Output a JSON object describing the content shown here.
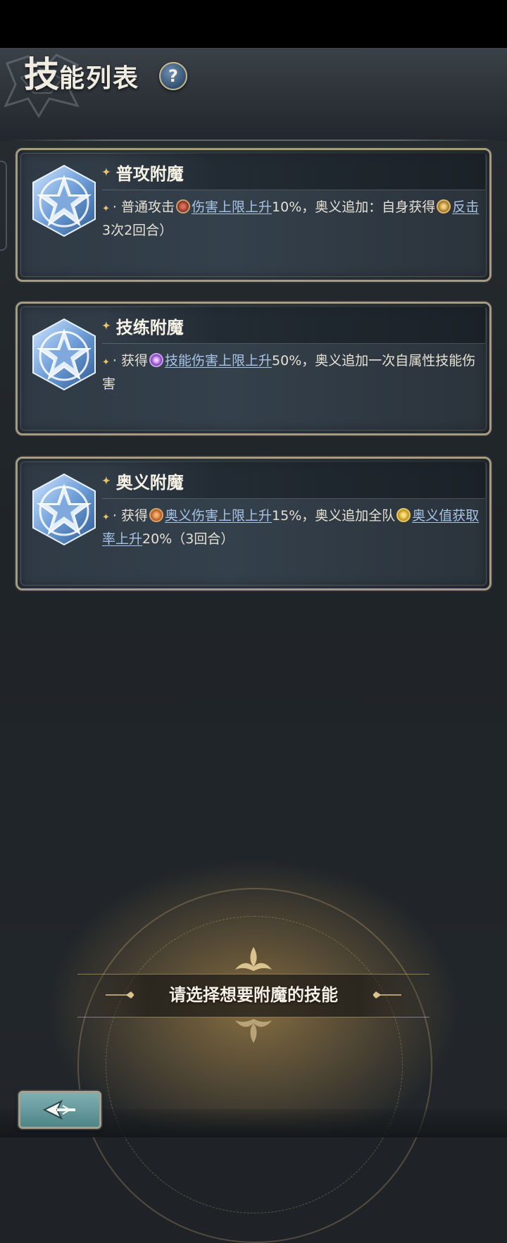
{
  "header": {
    "title_first": "技",
    "title_rest": "能列表",
    "help_label": "?"
  },
  "skills": [
    {
      "name": "普攻附魔",
      "desc": {
        "t1": "· 普通攻击",
        "k1": "伤害上限上升",
        "t2": "10%，奥义追加：自身获得",
        "k2": "反击",
        "t3": "3次2回合）"
      }
    },
    {
      "name": "技练附魔",
      "desc": {
        "t1": "· 获得",
        "k1": "技能伤害上限上升",
        "t2": "50%，奥义追加一次自属性技能伤害"
      }
    },
    {
      "name": "奥义附魔",
      "desc": {
        "t1": "· 获得",
        "k1": "奥义伤害上限上升",
        "t2": "15%，奥义追加全队",
        "k2": "奥义值获取率上升",
        "t3": "20%（3回合）"
      }
    }
  ],
  "prompt": "请选择想要附魔的技能",
  "colors": {
    "card_border": "#a79c82",
    "keyword": "#a8c4e6",
    "accent_gold": "#e9c46a",
    "back_button": "#6a9ea0"
  },
  "icons": {
    "skill": "star-crest-icon",
    "back": "back-arrow-icon",
    "help": "question-mark-icon"
  }
}
